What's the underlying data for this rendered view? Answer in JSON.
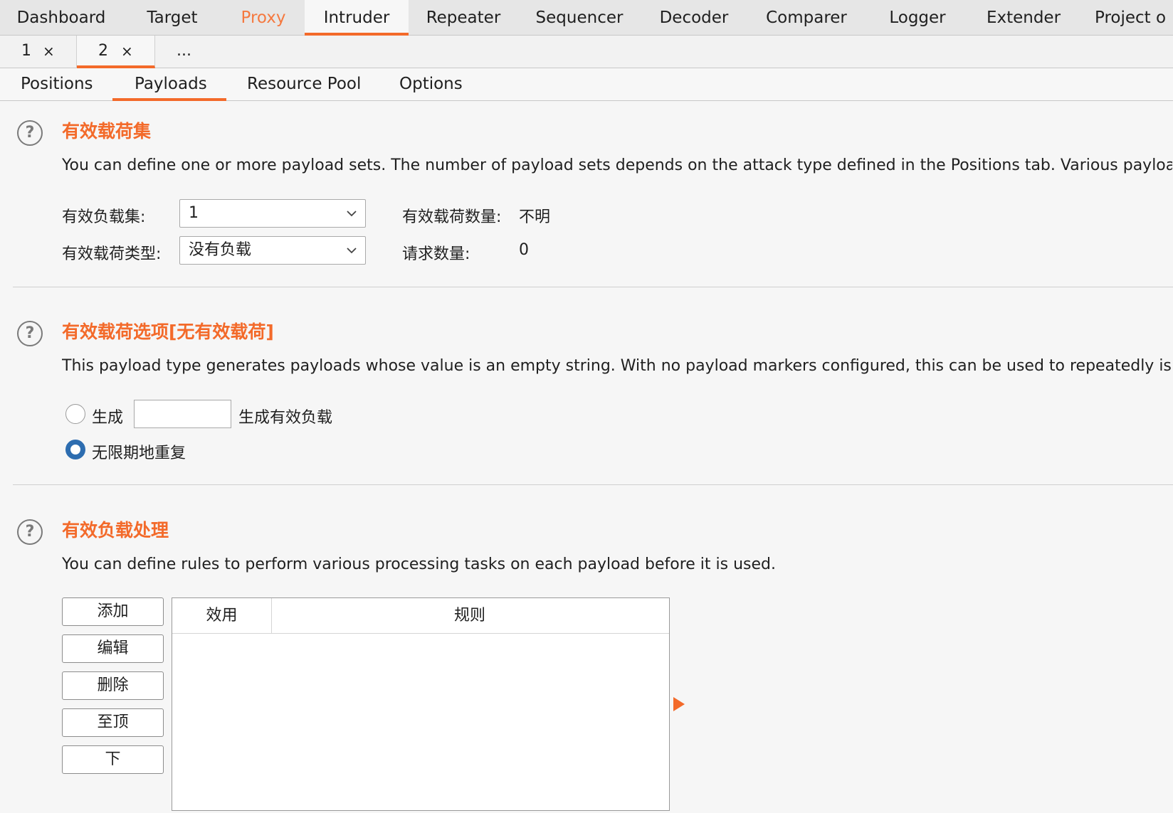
{
  "top_tabs": [
    "Dashboard",
    "Target",
    "Proxy",
    "Intruder",
    "Repeater",
    "Sequencer",
    "Decoder",
    "Comparer",
    "Logger",
    "Extender",
    "Project o"
  ],
  "instance_tabs": [
    {
      "num": "1",
      "close": "×"
    },
    {
      "num": "2",
      "close": "×"
    }
  ],
  "instance_more": "...",
  "sub_tabs": [
    "Positions",
    "Payloads",
    "Resource Pool",
    "Options"
  ],
  "payload_sets": {
    "title": "有效载荷集",
    "description": "You can define one or more payload sets. The number of payload sets depends on the attack type defined in the Positions tab. Various payload types are available for each payload set.",
    "set_label": "有效负载集:",
    "set_value": "1",
    "type_label": "有效载荷类型:",
    "type_value": "没有负载",
    "count_label": "有效载荷数量:",
    "count_value": "不明",
    "requests_label": "请求数量:",
    "requests_value": "0"
  },
  "payload_options": {
    "title": "有效载荷选项[无有效载荷]",
    "description": "This payload type generates payloads whose value is an empty string. With no payload markers configured, this can be used to repeatedly issue the base request unmodified.",
    "generate_label": "生成",
    "generate_suffix": "生成有效负载",
    "generate_value": "",
    "repeat_label": "无限期地重复"
  },
  "payload_processing": {
    "title": "有效负载处理",
    "description": "You can define rules to perform various processing tasks on each payload before it is used.",
    "buttons": [
      "添加",
      "编辑",
      "删除",
      "至顶",
      "下"
    ],
    "columns": [
      "效用",
      "规则"
    ]
  },
  "help_glyph": "?",
  "colors": {
    "accent": "#f36a2a",
    "radio": "#2d6db0"
  },
  "icons": [
    "help-icon",
    "chevron-down-icon",
    "arrow-right-icon"
  ]
}
